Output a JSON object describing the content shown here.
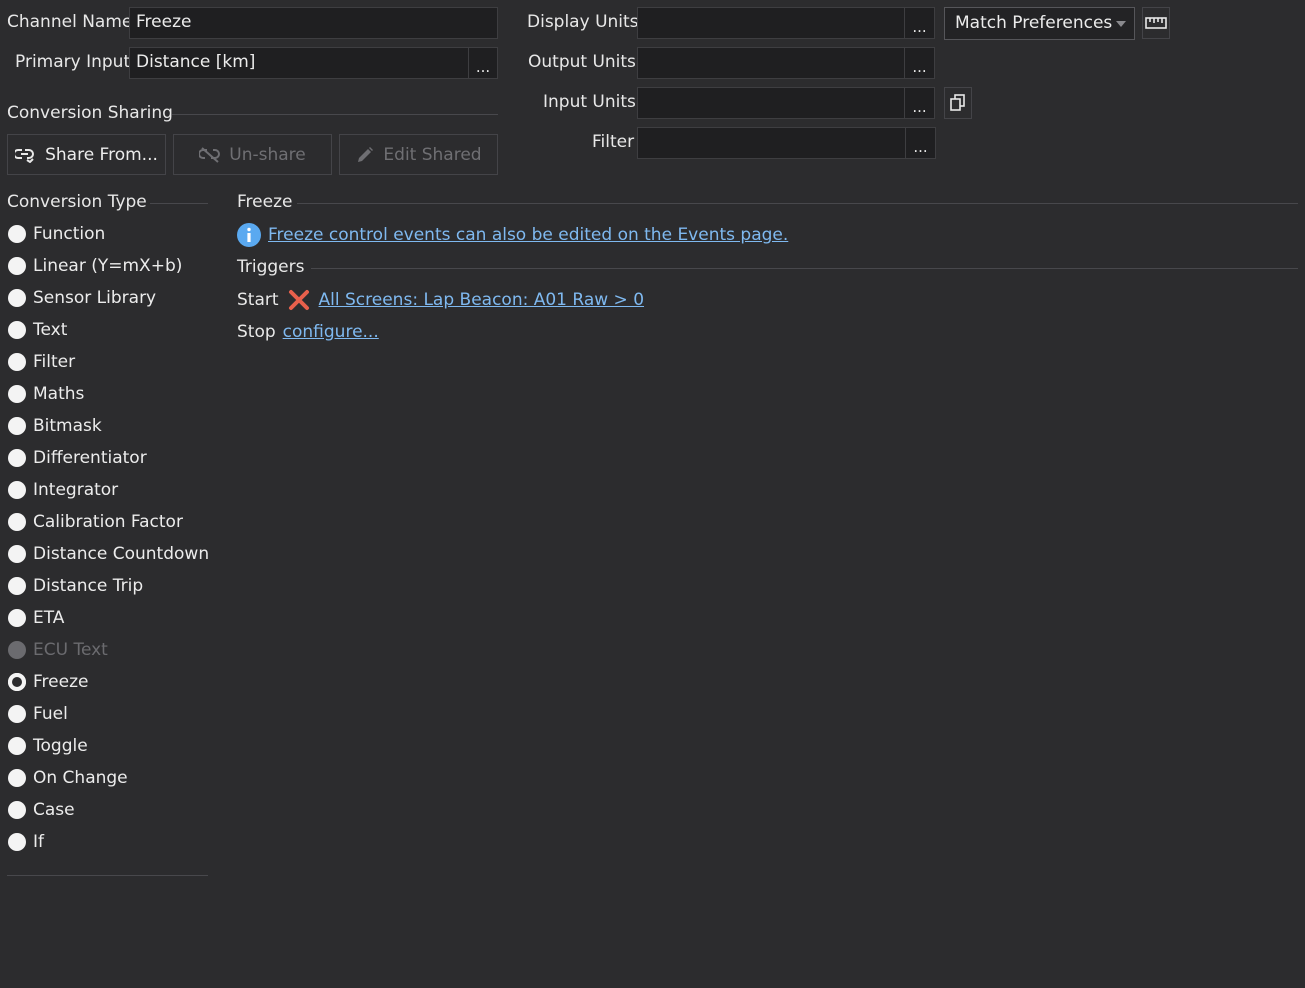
{
  "channel": {
    "name_label": "Channel Name",
    "name_value": "Freeze",
    "primary_input_label": "Primary Input",
    "primary_input_value": "Distance [km]",
    "browse_label": "..."
  },
  "units": {
    "display_label": "Display Units",
    "output_label": "Output Units",
    "input_label": "Input Units",
    "filter_label": "Filter",
    "display_value": "",
    "output_value": "",
    "input_value": "",
    "filter_value": "",
    "browse_label": "...",
    "match_select": "Match Preferences",
    "ruler_icon": "ruler-icon",
    "copy_icon": "copy-icon"
  },
  "sharing": {
    "title": "Conversion Sharing",
    "share_from": "Share From...",
    "unshare": "Un-share",
    "edit_shared": "Edit Shared"
  },
  "conversion_type": {
    "title": "Conversion Type",
    "selected": "Freeze",
    "options": [
      "Function",
      "Linear (Y=mX+b)",
      "Sensor Library",
      "Text",
      "Filter",
      "Maths",
      "Bitmask",
      "Differentiator",
      "Integrator",
      "Calibration Factor",
      "Distance Countdown",
      "Distance Trip",
      "ETA",
      "ECU Text",
      "Freeze",
      "Fuel",
      "Toggle",
      "On Change",
      "Case",
      "If"
    ],
    "disabled": [
      "ECU Text"
    ]
  },
  "freeze": {
    "title": "Freeze",
    "info_link": "Freeze control events can also be edited on the Events page.",
    "triggers_title": "Triggers",
    "start_label": "Start",
    "start_link": "All Screens: Lap Beacon: A01 Raw > 0",
    "stop_label": "Stop",
    "stop_link": "configure..."
  },
  "colors": {
    "background": "#2c2c2e",
    "field_bg": "#1f1f21",
    "link": "#7fb9f0",
    "info": "#5aa9f0",
    "delete": "#e8604c"
  }
}
